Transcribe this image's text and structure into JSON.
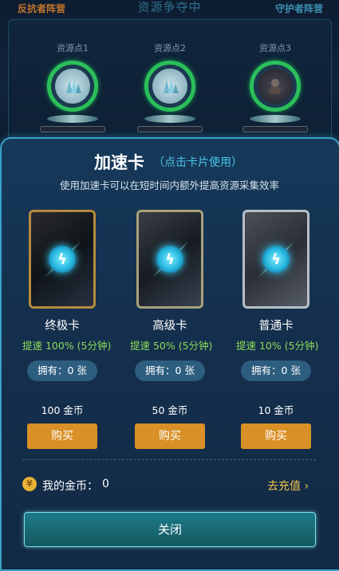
{
  "header": {
    "left_faction": "反抗者阵营",
    "title": "资源争夺中",
    "right_faction": "守护者阵营"
  },
  "resource_points": [
    {
      "label": "资源点1",
      "icon": "crystal-icon"
    },
    {
      "label": "资源点2",
      "icon": "crystal-icon"
    },
    {
      "label": "资源点3",
      "icon": "avatar-icon"
    }
  ],
  "modal": {
    "title": "加速卡",
    "hint": "（点击卡片使用）",
    "description": "使用加速卡可以在短时间内额外提高资源采集效率",
    "cards": [
      {
        "name": "终极卡",
        "boost": "提速 100% (5分钟)",
        "owned": "拥有：0 张",
        "price": "100 金币",
        "buy_label": "购买"
      },
      {
        "name": "高级卡",
        "boost": "提速 50% (5分钟)",
        "owned": "拥有：0 张",
        "price": "50 金币",
        "buy_label": "购买"
      },
      {
        "name": "普通卡",
        "boost": "提速 10% (5分钟)",
        "owned": "拥有：0 张",
        "price": "10 金币",
        "buy_label": "购买"
      }
    ],
    "coins": {
      "icon_glyph": "¥",
      "label": "我的金币：",
      "value": "0"
    },
    "recharge_label": "去充值 ›",
    "close_label": "关闭"
  },
  "colors": {
    "boost_green": "#8ddc5a",
    "buy_orange": "#d99026",
    "accent_cyan": "#48c6e9",
    "recharge_gold": "#f0c24a"
  }
}
